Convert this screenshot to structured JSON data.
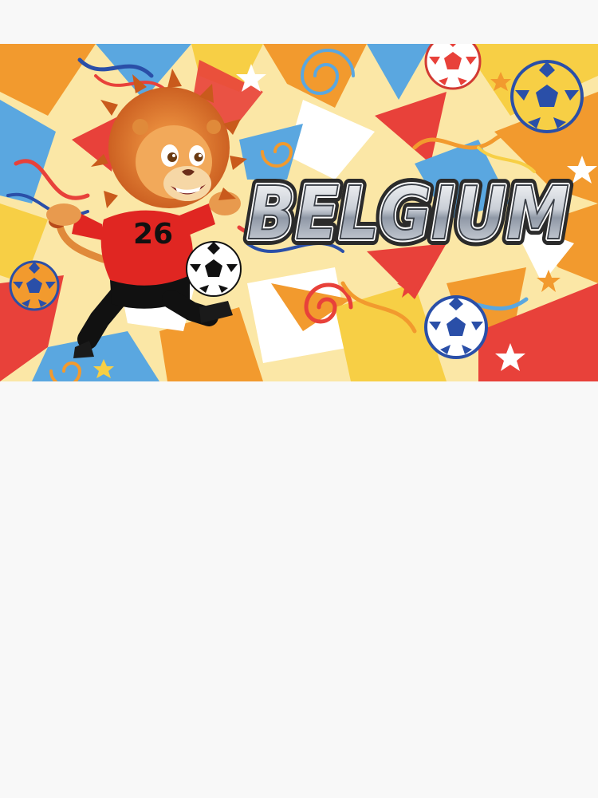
{
  "banner": {
    "title": "BELGIUM",
    "jersey_number": "26"
  },
  "mascot": {
    "animal": "lion",
    "kit_color": "#e02622",
    "shorts_color": "#111111"
  },
  "palette": {
    "yellow": "#f7cf45",
    "orange": "#f29a2e",
    "red": "#e8413a",
    "blue": "#5aa7e0",
    "navy": "#2a4fa8",
    "white": "#ffffff",
    "backdrop": "#f8f8f8"
  },
  "icons": [
    "soccer-ball-icon",
    "star-icon",
    "swirl-icon"
  ]
}
